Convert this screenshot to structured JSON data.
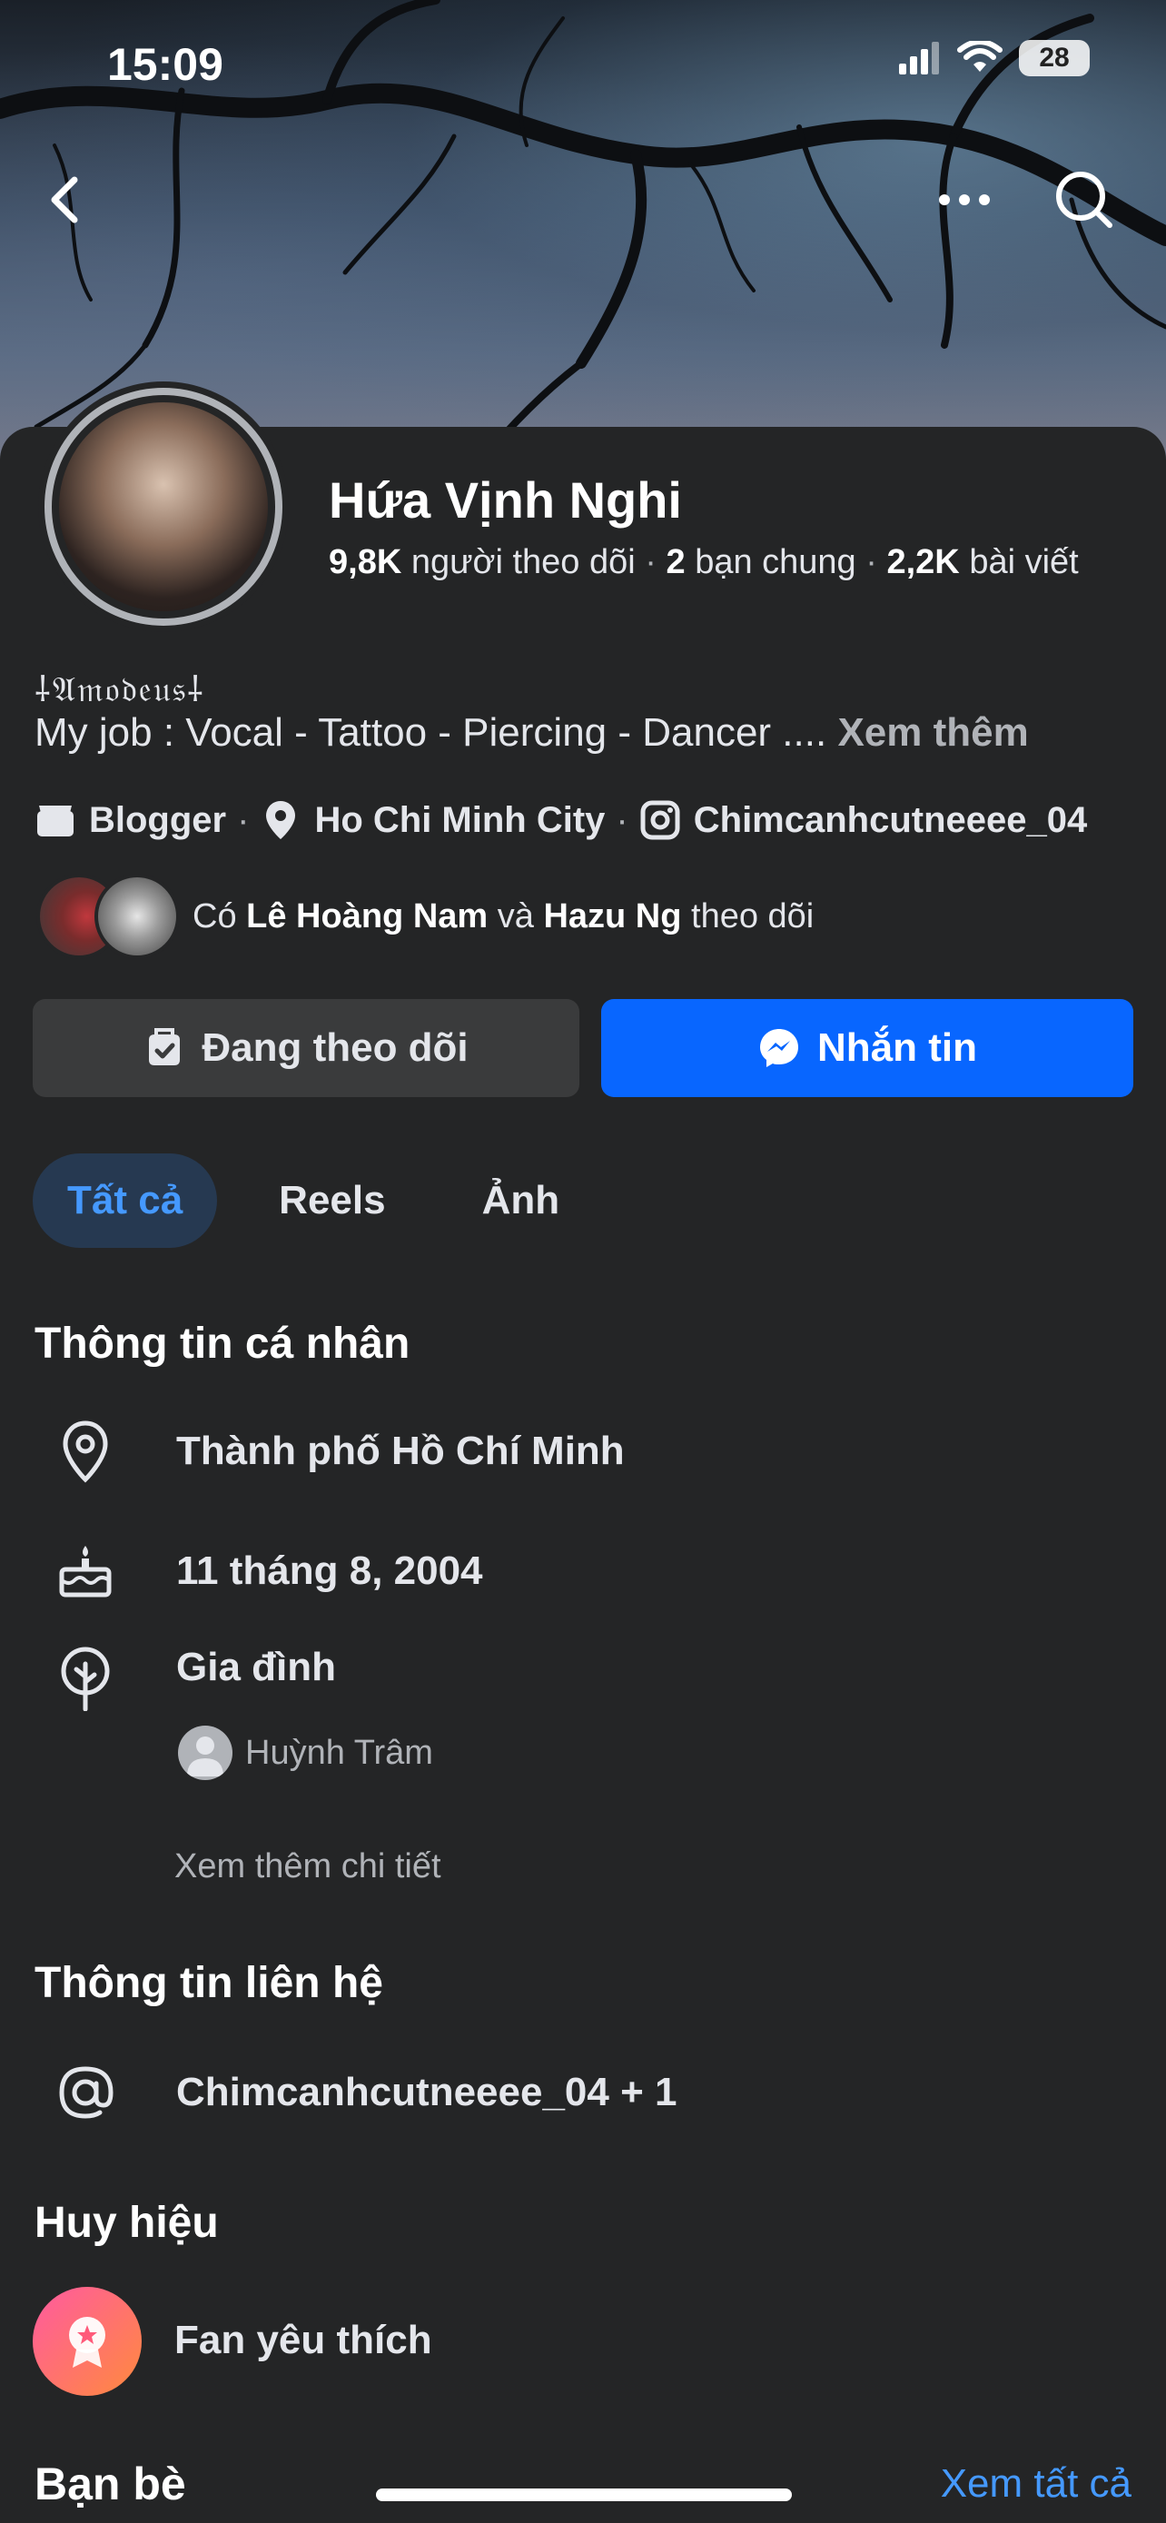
{
  "status_bar": {
    "time": "15:09",
    "battery": "28"
  },
  "profile": {
    "name": "Hứa Vịnh Nghi",
    "followers_count": "9,8K",
    "followers_label": "người theo dõi",
    "mutual_count": "2",
    "mutual_label": "bạn chung",
    "posts_count": "2,2K",
    "posts_label": "bài viết",
    "deco_line": "⸸𝔄𝔪𝔬𝔡𝔢𝔲𝔰⸸",
    "bio": "My job : Vocal - Tattoo - Piercing - Dancer  ....",
    "bio_more": "Xem thêm",
    "category": "Blogger",
    "city": "Ho Chi Minh City",
    "instagram": "Chimcanhcutneeee_04"
  },
  "mutual_followers": {
    "prefix": "Có",
    "name1": "Lê Hoàng Nam",
    "joiner": "và",
    "name2": "Hazu Ng",
    "suffix": "theo dõi"
  },
  "actions": {
    "following": "Đang theo dõi",
    "message": "Nhắn tin"
  },
  "tabs": [
    {
      "label": "Tất cả",
      "active": true
    },
    {
      "label": "Reels",
      "active": false
    },
    {
      "label": "Ảnh",
      "active": false
    }
  ],
  "personal_info": {
    "title": "Thông tin cá nhân",
    "location": "Thành phố Hồ Chí Minh",
    "birthday": "11 tháng 8, 2004",
    "family_label": "Gia đình",
    "family_member": "Huỳnh Trâm",
    "see_more": "Xem thêm chi tiết"
  },
  "contact_info": {
    "title": "Thông tin liên hệ",
    "handle": "Chimcanhcutneeee_04 + 1"
  },
  "badges": {
    "title": "Huy hiệu",
    "badge": "Fan yêu thích"
  },
  "friends": {
    "title": "Bạn bè",
    "see_all": "Xem tất cả"
  },
  "colors": {
    "accent": "#0866ff",
    "link": "#4599ff",
    "background": "#242526",
    "button_dark": "#3a3b3c"
  }
}
